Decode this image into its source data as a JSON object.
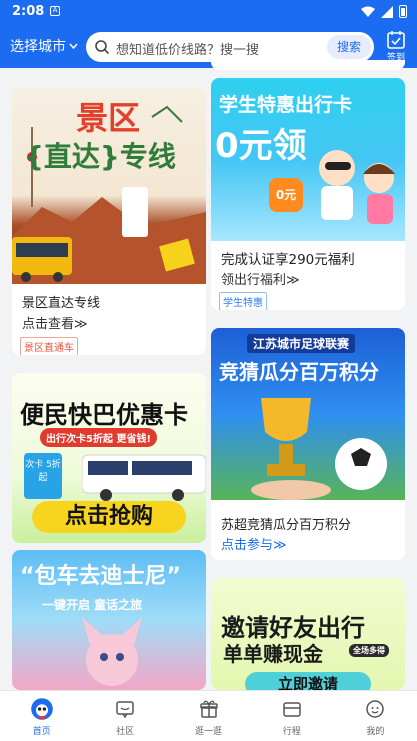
{
  "status": {
    "time": "2:08"
  },
  "nav": {
    "city_label": "选择城市",
    "search_placeholder": "想知道低价线路？搜一搜",
    "search_button": "搜索",
    "checkin_label": "签到"
  },
  "cards": {
    "scenic": {
      "banner_line1": "景区",
      "banner_line2": "{直达}专线",
      "title": "景区直达专线",
      "link": "点击查看≫",
      "tag": "景区直通车"
    },
    "student": {
      "banner_line1": "学生特惠出行卡",
      "banner_line2": "0元领",
      "badge": "0元",
      "title": "完成认证享290元福利",
      "link": "领出行福利≫",
      "tag": "学生特惠"
    },
    "football": {
      "banner_line1": "江苏城市足球联赛",
      "banner_line2": "竞猜瓜分百万积分",
      "title": "苏超竞猜瓜分百万积分",
      "link": "点击参与≫"
    },
    "travelcard": {
      "banner_line1": "便民快巴优惠卡",
      "banner_line2": "出行次卡5折起 更省钱!",
      "card_label": "次卡 5折起",
      "button": "点击抢购"
    },
    "disney": {
      "banner_line1": "“包车去迪士尼”",
      "banner_line2": "一键开启  童话之旅"
    },
    "invite": {
      "banner_line1": "邀请好友出行",
      "banner_line2": "单单赚现金",
      "chip": "全场多得",
      "button": "立即邀请"
    }
  },
  "tabs": [
    {
      "label": "首页",
      "icon": "home-mascot-icon",
      "active": true
    },
    {
      "label": "社区",
      "icon": "chat-bubble-icon",
      "active": false
    },
    {
      "label": "逛一逛",
      "icon": "gift-box-icon",
      "active": false
    },
    {
      "label": "行程",
      "icon": "ticket-icon",
      "active": false
    },
    {
      "label": "我的",
      "icon": "smiley-face-icon",
      "active": false
    }
  ],
  "colors": {
    "brand_blue": "#1b6cf0",
    "tag_red": "#e8543b",
    "tag_blue": "#2d7df5"
  }
}
